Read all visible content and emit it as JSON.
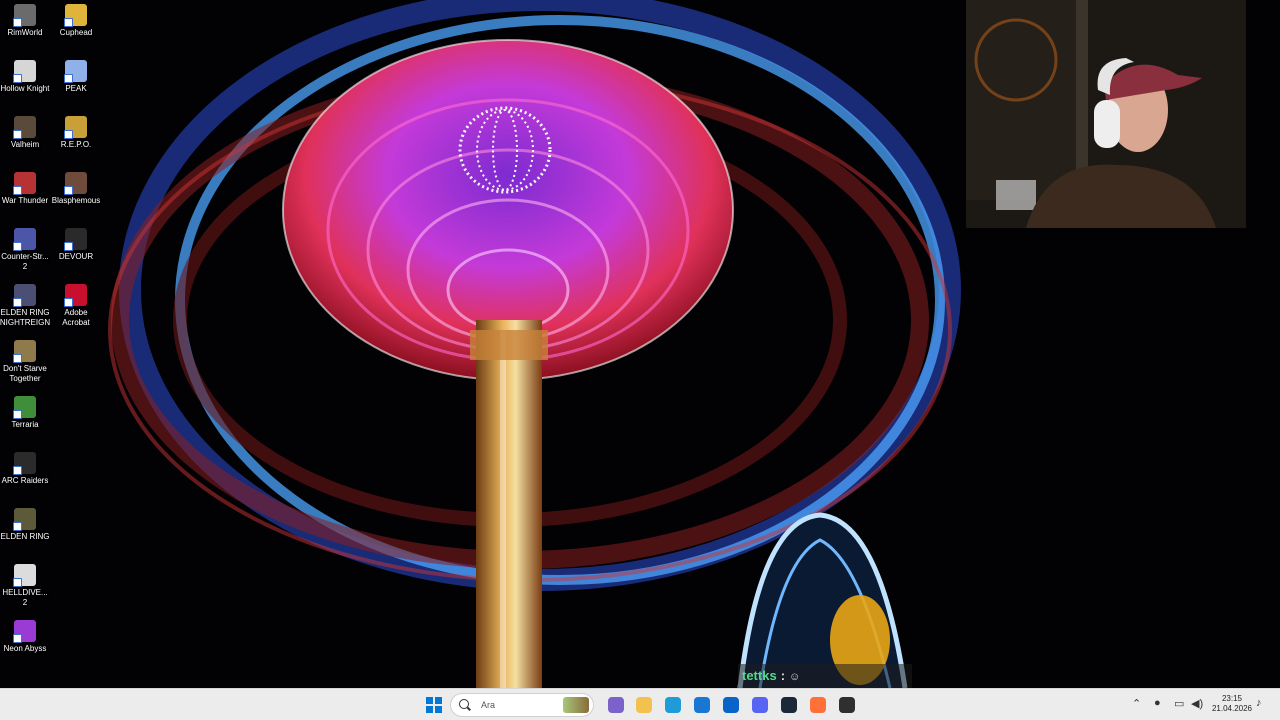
{
  "desktop": {
    "icons": [
      {
        "label": "RimWorld",
        "icon": "rimworld-icon",
        "color": "#6b6b6b"
      },
      {
        "label": "Cuphead",
        "icon": "cuphead-icon",
        "color": "#e0b43a"
      },
      {
        "label": "Hollow Knight",
        "icon": "hollow-knight-icon",
        "color": "#d6d6d6"
      },
      {
        "label": "PEAK",
        "icon": "peak-icon",
        "color": "#8fb0e8"
      },
      {
        "label": "Valheim",
        "icon": "valheim-icon",
        "color": "#5a4a3a"
      },
      {
        "label": "R.E.P.O.",
        "icon": "repo-icon",
        "color": "#c9a038"
      },
      {
        "label": "War Thunder",
        "icon": "war-thunder-icon",
        "color": "#b73232"
      },
      {
        "label": "Blasphemous",
        "icon": "blasphemous-icon",
        "color": "#6e4b3a"
      },
      {
        "label": "Counter-Str... 2",
        "icon": "counter-strike-icon",
        "color": "#4c56a8"
      },
      {
        "label": "DEVOUR",
        "icon": "devour-icon",
        "color": "#2a2a2a"
      },
      {
        "label": "ELDEN RING NIGHTREIGN",
        "icon": "elden-ring-nightreign-icon",
        "color": "#4a4f73"
      },
      {
        "label": "Adobe Acrobat",
        "icon": "adobe-acrobat-icon",
        "color": "#c8102e"
      },
      {
        "label": "Don't Starve Together",
        "icon": "dont-starve-icon",
        "color": "#8e7a4a"
      },
      {
        "label": "Terraria",
        "icon": "terraria-icon",
        "color": "#3f8f3a"
      },
      {
        "label": "ARC Raiders",
        "icon": "arc-raiders-icon",
        "color": "#2b2b2b"
      },
      {
        "label": "ELDEN RING",
        "icon": "elden-ring-icon",
        "color": "#5d5a3a"
      },
      {
        "label": "HELLDIVE... 2",
        "icon": "helldivers-icon",
        "color": "#dcdcdc"
      },
      {
        "label": "Neon Abyss",
        "icon": "neon-abyss-icon",
        "color": "#9b3bd6"
      }
    ]
  },
  "chat": {
    "user": "tettks",
    "separator": ":"
  },
  "taskbar": {
    "search_placeholder": "Ara",
    "apps": [
      {
        "name": "start-button",
        "icon": "windows-icon",
        "color": "#0078d4"
      },
      {
        "name": "task-view",
        "icon": "widgets-icon",
        "color": "#7b61c9"
      },
      {
        "name": "file-explorer",
        "icon": "folder-icon",
        "color": "#f2c14e"
      },
      {
        "name": "edge",
        "icon": "edge-icon",
        "color": "#1f9bd8"
      },
      {
        "name": "store",
        "icon": "store-icon",
        "color": "#1976d2"
      },
      {
        "name": "outlook",
        "icon": "outlook-icon",
        "color": "#0a64c8"
      },
      {
        "name": "discord",
        "icon": "discord-icon",
        "color": "#5865f2"
      },
      {
        "name": "steam",
        "icon": "steam-icon",
        "color": "#1b2838"
      },
      {
        "name": "firefox",
        "icon": "firefox-icon",
        "color": "#ff7139"
      },
      {
        "name": "obs",
        "icon": "obs-icon",
        "color": "#302e31"
      }
    ],
    "time": "23:15",
    "date": "21.04.2026"
  }
}
